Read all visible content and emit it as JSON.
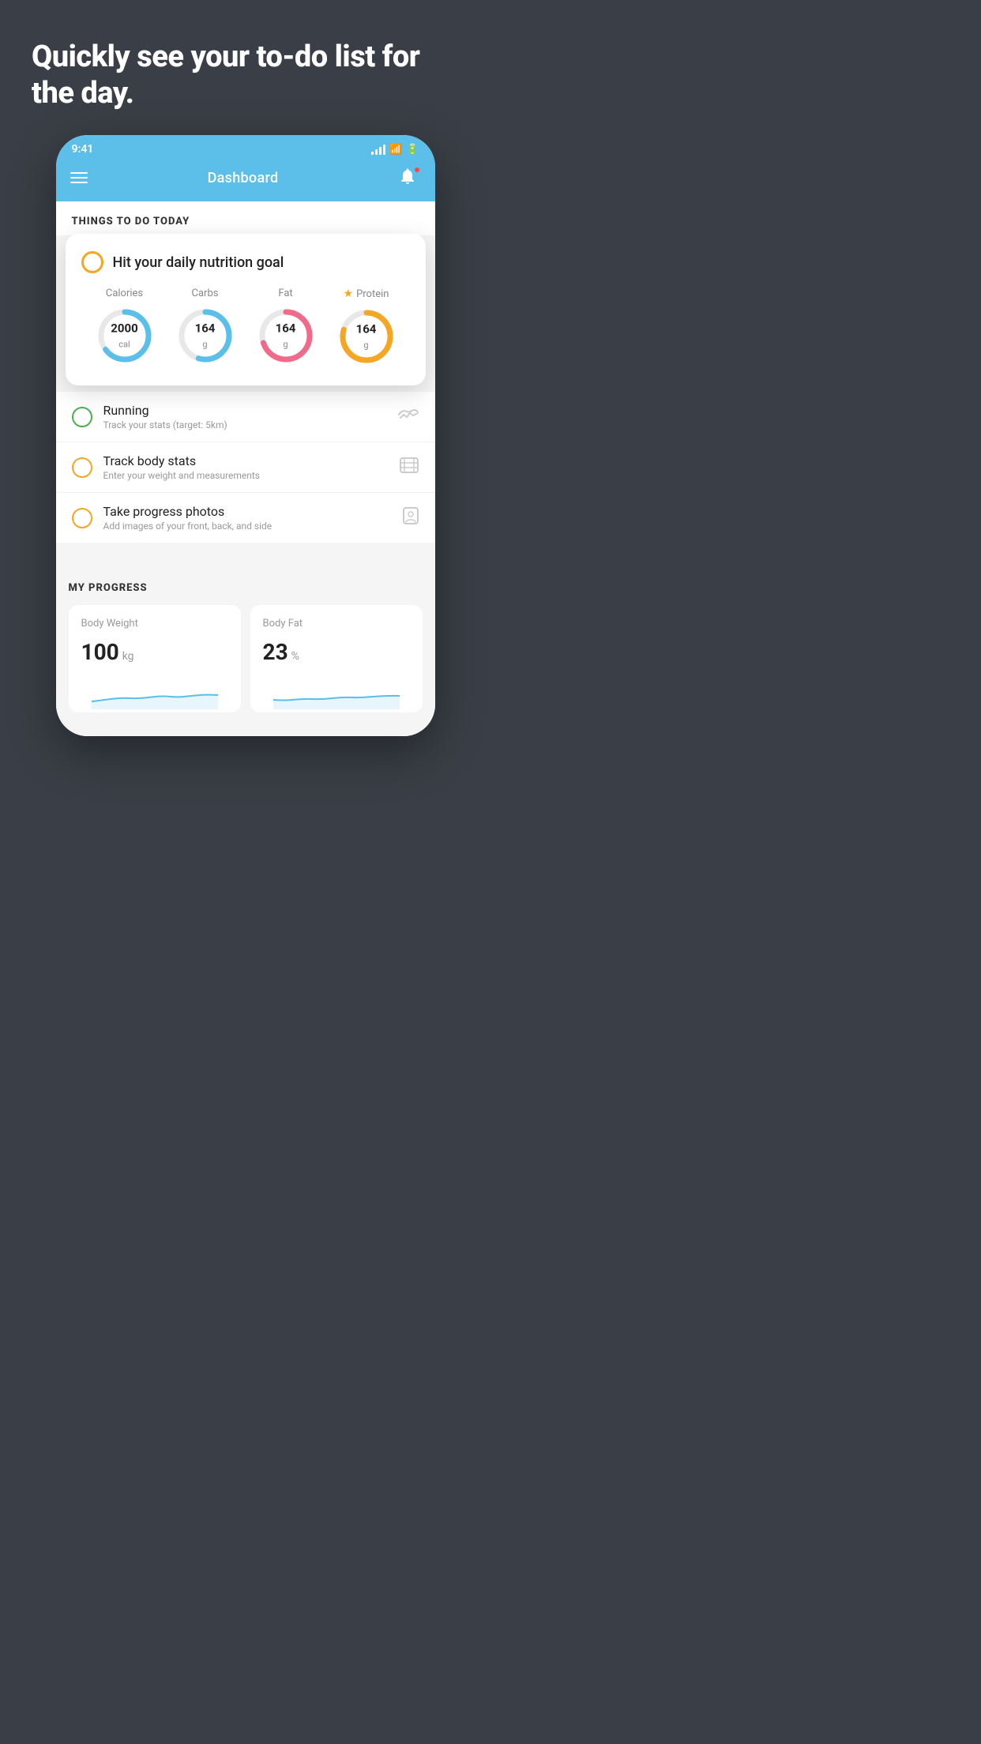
{
  "hero": {
    "title": "Quickly see your to-do list for the day."
  },
  "status_bar": {
    "time": "9:41"
  },
  "header": {
    "title": "Dashboard"
  },
  "things_section": {
    "title": "THINGS TO DO TODAY"
  },
  "nutrition_card": {
    "title": "Hit your daily nutrition goal",
    "nutrients": [
      {
        "label": "Calories",
        "value": "2000",
        "unit": "cal",
        "color": "#5bbfea",
        "track_color": "#e8e8e8",
        "percent": 65
      },
      {
        "label": "Carbs",
        "value": "164",
        "unit": "g",
        "color": "#5bbfea",
        "track_color": "#e8e8e8",
        "percent": 55
      },
      {
        "label": "Fat",
        "value": "164",
        "unit": "g",
        "color": "#f06b8a",
        "track_color": "#e8e8e8",
        "percent": 70
      },
      {
        "label": "Protein",
        "value": "164",
        "unit": "g",
        "color": "#f5a623",
        "track_color": "#e8e8e8",
        "percent": 80,
        "starred": true
      }
    ]
  },
  "todo_items": [
    {
      "name": "Running",
      "sub": "Track your stats (target: 5km)",
      "circle_color": "green",
      "icon": "👟"
    },
    {
      "name": "Track body stats",
      "sub": "Enter your weight and measurements",
      "circle_color": "yellow",
      "icon": "⊡"
    },
    {
      "name": "Take progress photos",
      "sub": "Add images of your front, back, and side",
      "circle_color": "yellow",
      "icon": "👤"
    }
  ],
  "progress": {
    "title": "MY PROGRESS",
    "cards": [
      {
        "title": "Body Weight",
        "value": "100",
        "unit": "kg"
      },
      {
        "title": "Body Fat",
        "value": "23",
        "unit": "%"
      }
    ]
  }
}
